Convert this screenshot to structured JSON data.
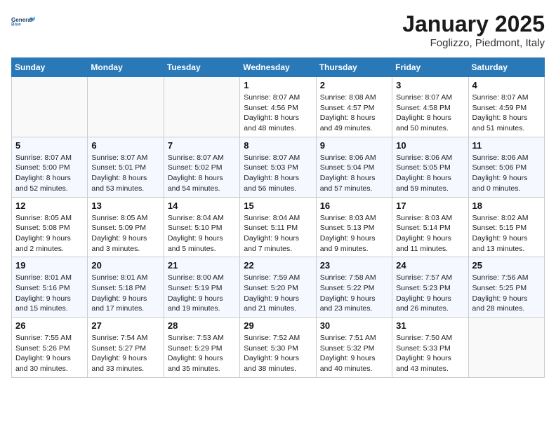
{
  "header": {
    "logo_line1": "General",
    "logo_line2": "Blue",
    "month": "January 2025",
    "location": "Foglizzo, Piedmont, Italy"
  },
  "weekdays": [
    "Sunday",
    "Monday",
    "Tuesday",
    "Wednesday",
    "Thursday",
    "Friday",
    "Saturday"
  ],
  "weeks": [
    [
      {
        "day": "",
        "info": ""
      },
      {
        "day": "",
        "info": ""
      },
      {
        "day": "",
        "info": ""
      },
      {
        "day": "1",
        "info": "Sunrise: 8:07 AM\nSunset: 4:56 PM\nDaylight: 8 hours\nand 48 minutes."
      },
      {
        "day": "2",
        "info": "Sunrise: 8:08 AM\nSunset: 4:57 PM\nDaylight: 8 hours\nand 49 minutes."
      },
      {
        "day": "3",
        "info": "Sunrise: 8:07 AM\nSunset: 4:58 PM\nDaylight: 8 hours\nand 50 minutes."
      },
      {
        "day": "4",
        "info": "Sunrise: 8:07 AM\nSunset: 4:59 PM\nDaylight: 8 hours\nand 51 minutes."
      }
    ],
    [
      {
        "day": "5",
        "info": "Sunrise: 8:07 AM\nSunset: 5:00 PM\nDaylight: 8 hours\nand 52 minutes."
      },
      {
        "day": "6",
        "info": "Sunrise: 8:07 AM\nSunset: 5:01 PM\nDaylight: 8 hours\nand 53 minutes."
      },
      {
        "day": "7",
        "info": "Sunrise: 8:07 AM\nSunset: 5:02 PM\nDaylight: 8 hours\nand 54 minutes."
      },
      {
        "day": "8",
        "info": "Sunrise: 8:07 AM\nSunset: 5:03 PM\nDaylight: 8 hours\nand 56 minutes."
      },
      {
        "day": "9",
        "info": "Sunrise: 8:06 AM\nSunset: 5:04 PM\nDaylight: 8 hours\nand 57 minutes."
      },
      {
        "day": "10",
        "info": "Sunrise: 8:06 AM\nSunset: 5:05 PM\nDaylight: 8 hours\nand 59 minutes."
      },
      {
        "day": "11",
        "info": "Sunrise: 8:06 AM\nSunset: 5:06 PM\nDaylight: 9 hours\nand 0 minutes."
      }
    ],
    [
      {
        "day": "12",
        "info": "Sunrise: 8:05 AM\nSunset: 5:08 PM\nDaylight: 9 hours\nand 2 minutes."
      },
      {
        "day": "13",
        "info": "Sunrise: 8:05 AM\nSunset: 5:09 PM\nDaylight: 9 hours\nand 3 minutes."
      },
      {
        "day": "14",
        "info": "Sunrise: 8:04 AM\nSunset: 5:10 PM\nDaylight: 9 hours\nand 5 minutes."
      },
      {
        "day": "15",
        "info": "Sunrise: 8:04 AM\nSunset: 5:11 PM\nDaylight: 9 hours\nand 7 minutes."
      },
      {
        "day": "16",
        "info": "Sunrise: 8:03 AM\nSunset: 5:13 PM\nDaylight: 9 hours\nand 9 minutes."
      },
      {
        "day": "17",
        "info": "Sunrise: 8:03 AM\nSunset: 5:14 PM\nDaylight: 9 hours\nand 11 minutes."
      },
      {
        "day": "18",
        "info": "Sunrise: 8:02 AM\nSunset: 5:15 PM\nDaylight: 9 hours\nand 13 minutes."
      }
    ],
    [
      {
        "day": "19",
        "info": "Sunrise: 8:01 AM\nSunset: 5:16 PM\nDaylight: 9 hours\nand 15 minutes."
      },
      {
        "day": "20",
        "info": "Sunrise: 8:01 AM\nSunset: 5:18 PM\nDaylight: 9 hours\nand 17 minutes."
      },
      {
        "day": "21",
        "info": "Sunrise: 8:00 AM\nSunset: 5:19 PM\nDaylight: 9 hours\nand 19 minutes."
      },
      {
        "day": "22",
        "info": "Sunrise: 7:59 AM\nSunset: 5:20 PM\nDaylight: 9 hours\nand 21 minutes."
      },
      {
        "day": "23",
        "info": "Sunrise: 7:58 AM\nSunset: 5:22 PM\nDaylight: 9 hours\nand 23 minutes."
      },
      {
        "day": "24",
        "info": "Sunrise: 7:57 AM\nSunset: 5:23 PM\nDaylight: 9 hours\nand 26 minutes."
      },
      {
        "day": "25",
        "info": "Sunrise: 7:56 AM\nSunset: 5:25 PM\nDaylight: 9 hours\nand 28 minutes."
      }
    ],
    [
      {
        "day": "26",
        "info": "Sunrise: 7:55 AM\nSunset: 5:26 PM\nDaylight: 9 hours\nand 30 minutes."
      },
      {
        "day": "27",
        "info": "Sunrise: 7:54 AM\nSunset: 5:27 PM\nDaylight: 9 hours\nand 33 minutes."
      },
      {
        "day": "28",
        "info": "Sunrise: 7:53 AM\nSunset: 5:29 PM\nDaylight: 9 hours\nand 35 minutes."
      },
      {
        "day": "29",
        "info": "Sunrise: 7:52 AM\nSunset: 5:30 PM\nDaylight: 9 hours\nand 38 minutes."
      },
      {
        "day": "30",
        "info": "Sunrise: 7:51 AM\nSunset: 5:32 PM\nDaylight: 9 hours\nand 40 minutes."
      },
      {
        "day": "31",
        "info": "Sunrise: 7:50 AM\nSunset: 5:33 PM\nDaylight: 9 hours\nand 43 minutes."
      },
      {
        "day": "",
        "info": ""
      }
    ]
  ]
}
